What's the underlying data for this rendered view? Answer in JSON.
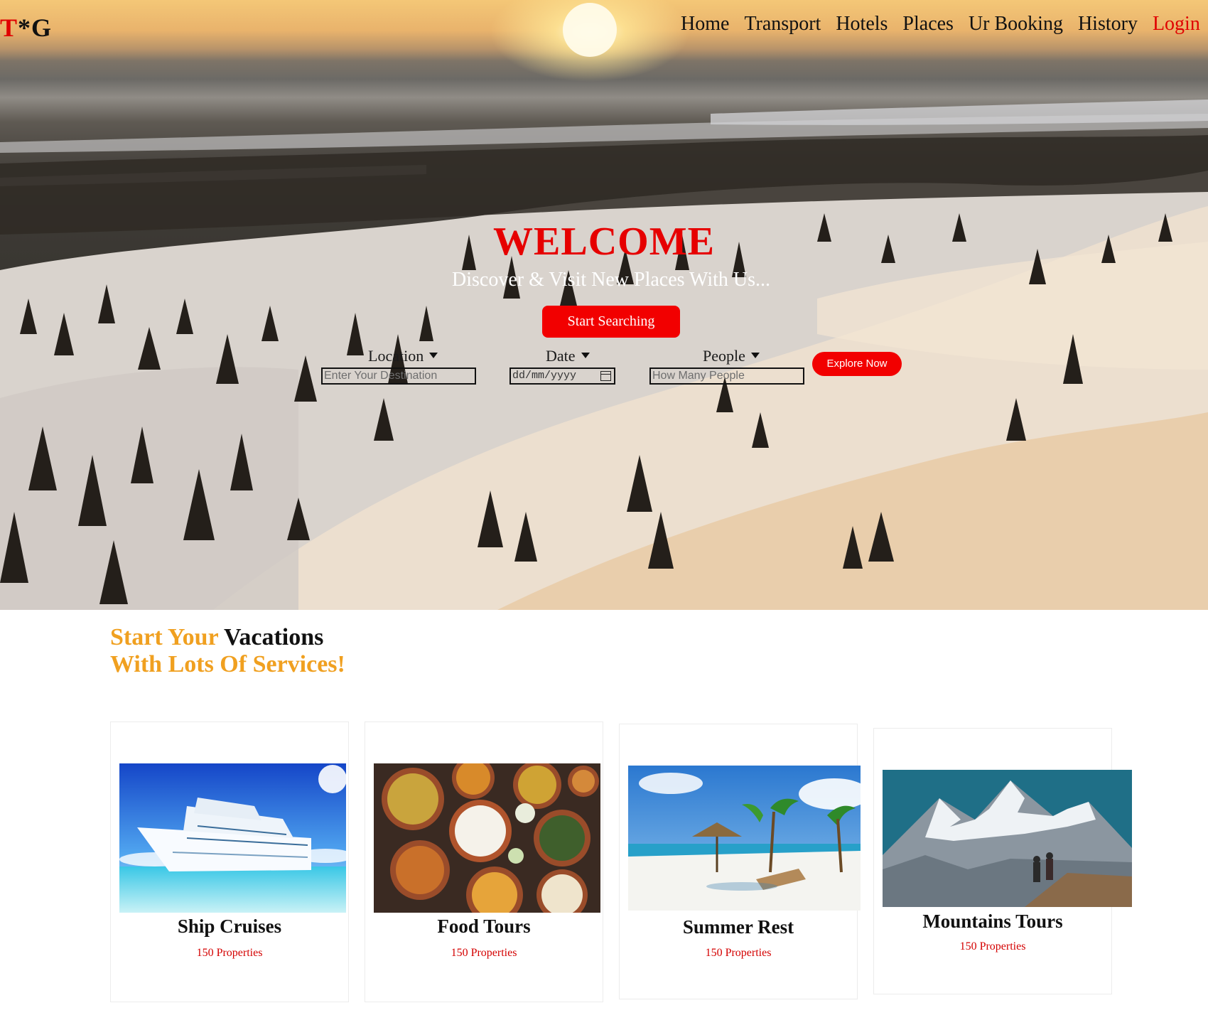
{
  "header": {
    "logo": {
      "t": "T",
      "rest": "*G"
    },
    "nav": [
      "Home",
      "Transport",
      "Hotels",
      "Places",
      "Ur Booking",
      "History"
    ],
    "login": "Login"
  },
  "hero": {
    "title": "WELCOME",
    "tagline": "Discover & Visit New Places With Us...",
    "start_button": "Start Searching",
    "search": {
      "location_label": "Location",
      "location_placeholder": "Enter Your Destination",
      "date_label": "Date",
      "date_placeholder": "dd/mm/yyyy",
      "people_label": "People",
      "people_placeholder": "How Many People",
      "explore_button": "Explore Now"
    }
  },
  "services": {
    "title_orange_1": "Start Your",
    "title_black": "Vacations",
    "title_orange_2": "With Lots Of Services!",
    "cards": [
      {
        "title": "Ship Cruises",
        "subtitle": "150 Properties"
      },
      {
        "title": "Food Tours",
        "subtitle": "150 Properties"
      },
      {
        "title": "Summer Rest",
        "subtitle": "150 Properties"
      },
      {
        "title": "Mountains Tours",
        "subtitle": "150 Properties"
      }
    ]
  },
  "colors": {
    "accent_red": "#f20000",
    "accent_orange": "#f0a020"
  }
}
